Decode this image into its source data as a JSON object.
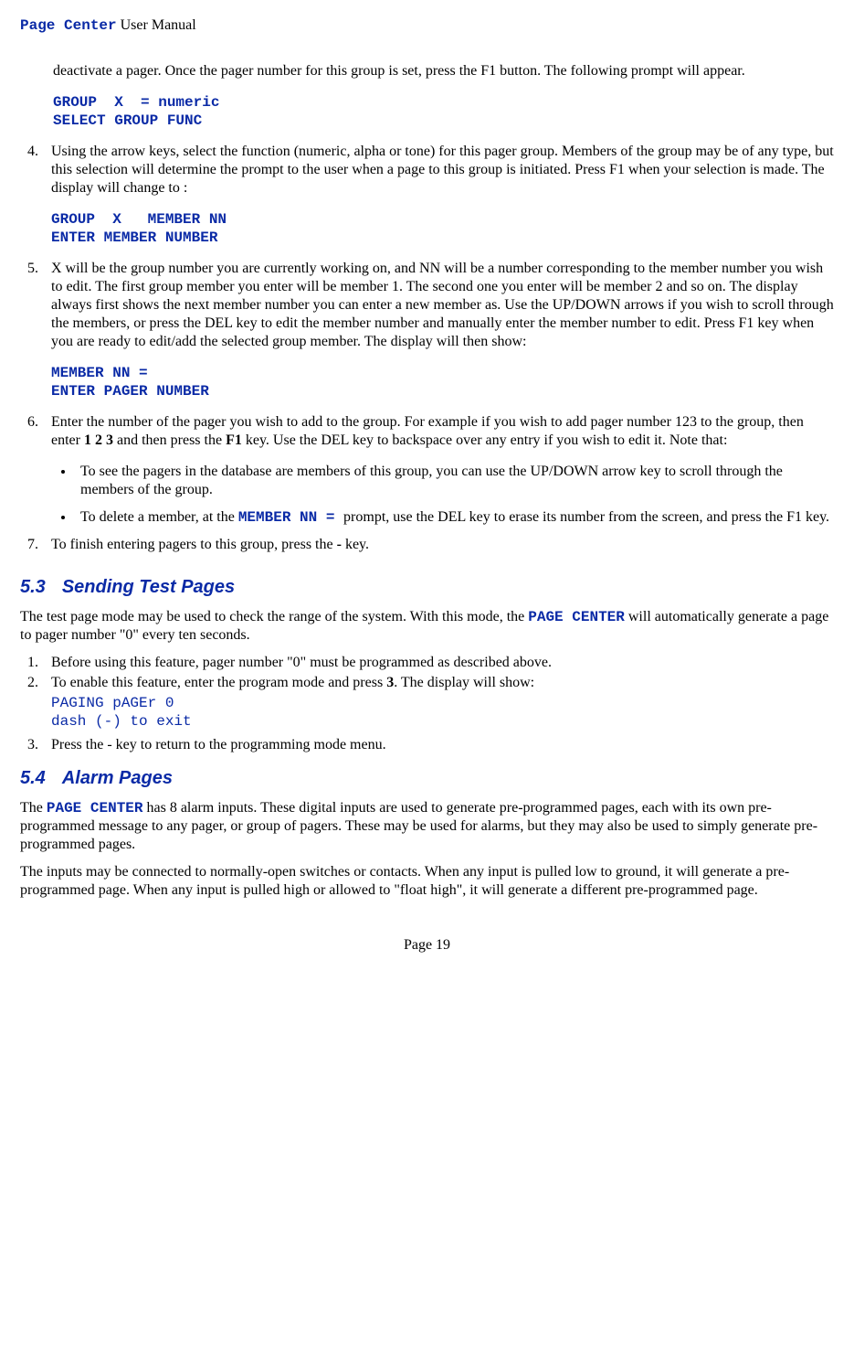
{
  "header": {
    "product": "Page Center",
    "doc": " User Manual"
  },
  "intro_para": "deactivate a pager. Once the pager number for this group is set, press the F1 button. The following prompt will appear.",
  "disp1": "GROUP  X  = numeric\nSELECT GROUP FUNC",
  "item4": "Using the arrow keys, select the function (numeric, alpha or tone) for this pager group.  Members of the group may be of any type, but this selection will determine the prompt to the user when a page to this group is initiated.   Press F1 when your selection is made. The display will change to :",
  "disp2": "GROUP  X   MEMBER NN\nENTER MEMBER NUMBER",
  "item5": "X will be the group number you are currently working on, and NN will be a number corresponding to the member number you wish to edit.  The first group member you enter will be member 1.  The second one you enter will be member 2 and so on.  The display always first shows the next member number you can enter a new member as. Use the UP/DOWN arrows if you wish to scroll through the members, or press the DEL key to edit the member number and manually enter the member number to edit. Press F1 key when you are ready to edit/add the selected group member. The display will then show:",
  "disp3": "MEMBER NN =\nENTER PAGER NUMBER",
  "item6_a": "Enter the number of the pager you wish to add to the group.  For example if you wish to add pager number 123 to the group, then enter ",
  "item6_b": "1 2 3",
  "item6_c": "  and then press the ",
  "item6_d": "F1",
  "item6_e": " key.  Use the DEL key to backspace over any entry if you wish to edit it.  Note that:",
  "bullet1": "To see the pagers in the database are members of this group, you can use the UP/DOWN arrow key to scroll through the members of the group.",
  "bullet2_a": "To delete a member, at the ",
  "bullet2_b": "MEMBER NN = ",
  "bullet2_c": " prompt, use the DEL key to erase its number from the screen, and press the F1 key.",
  "item7_a": "To finish entering pagers to this group, press the ",
  "item7_b": "-",
  "item7_c": " key.",
  "sec53_num": "5.3",
  "sec53_title": "Sending Test Pages",
  "sec53_p_a": "The test page mode may be used to check the range of the system.  With this mode, the ",
  "sec53_p_b": "PAGE CENTER",
  "sec53_p_c": " will automatically generate a page to pager number \"0\" every ten seconds.",
  "sec53_li1": "Before using this feature, pager number \"0\" must be programmed as described above.",
  "sec53_li2_a": "To enable this feature, enter the program mode and press ",
  "sec53_li2_b": "3",
  "sec53_li2_c": ".  The display will show:",
  "disp4": "PAGING pAGEr 0\ndash (-) to exit",
  "sec53_li3": "Press the - key to return to the programming mode menu.",
  "sec54_num": "5.4",
  "sec54_title": "Alarm Pages",
  "sec54_p1_a": "The ",
  "sec54_p1_b": "PAGE CENTER",
  "sec54_p1_c": " has 8 alarm inputs.  These digital inputs are used to generate pre-programmed pages, each with its own pre-programmed message to any pager, or group of pagers. These may be used for alarms, but they may also be used to simply generate pre-programmed pages.",
  "sec54_p2": "The inputs may be connected to normally-open switches or contacts.  When any input is pulled low to ground, it will generate a pre-programmed page. When any input is pulled high or allowed to \"float high\", it will generate a different pre-programmed page.",
  "footer": "Page 19"
}
